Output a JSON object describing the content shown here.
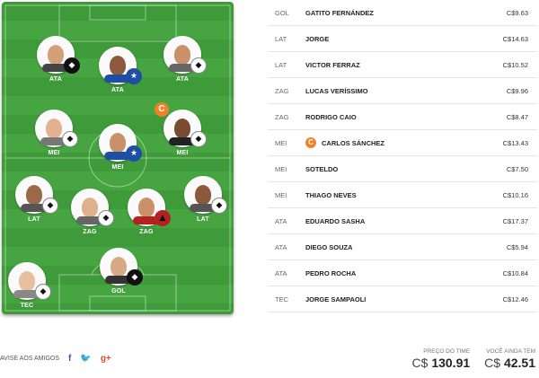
{
  "field": {
    "players": [
      {
        "pos": "ATA",
        "club": "Botafogo",
        "badge": "black",
        "skin": "#d3a07a",
        "shirt": "#444"
      },
      {
        "pos": "ATA",
        "club": "Cruzeiro",
        "badge": "blue",
        "skin": "#8c5a3c",
        "shirt": "#1f4fa3"
      },
      {
        "pos": "ATA",
        "club": "Santos",
        "badge": "white",
        "skin": "#c9906a",
        "shirt": "#666"
      },
      {
        "pos": "MEI",
        "club": "Santos",
        "badge": "white",
        "skin": "#e3b18f",
        "shirt": "#777"
      },
      {
        "pos": "MEI",
        "club": "Cruzeiro",
        "badge": "blue",
        "skin": "#c9906a",
        "shirt": "#1f4fa3"
      },
      {
        "pos": "MEI",
        "club": "Santos",
        "badge": "white",
        "skin": "#7a4b30",
        "shirt": "#222",
        "captain": true
      },
      {
        "pos": "LAT",
        "club": "Santos",
        "badge": "white",
        "skin": "#9a6a48",
        "shirt": "#555"
      },
      {
        "pos": "ZAG",
        "club": "Santos",
        "badge": "white",
        "skin": "#e0b08c",
        "shirt": "#666"
      },
      {
        "pos": "ZAG",
        "club": "Flamengo",
        "badge": "red",
        "skin": "#c9906a",
        "shirt": "#b52020"
      },
      {
        "pos": "LAT",
        "club": "Santos",
        "badge": "white",
        "skin": "#8a5a3a",
        "shirt": "#555"
      },
      {
        "pos": "TEC",
        "club": "Santos",
        "badge": "white",
        "skin": "#e6bfa0",
        "shirt": "#888"
      },
      {
        "pos": "GOL",
        "club": "Botafogo",
        "badge": "black",
        "skin": "#d8a985",
        "shirt": "#333"
      }
    ],
    "captain_letter": "C"
  },
  "list": [
    {
      "pos": "GOL",
      "name": "GATITO FERNÁNDEZ",
      "price": "C$9.63"
    },
    {
      "pos": "LAT",
      "name": "JORGE",
      "price": "C$14.63"
    },
    {
      "pos": "LAT",
      "name": "VICTOR FERRAZ",
      "price": "C$10.52"
    },
    {
      "pos": "ZAG",
      "name": "LUCAS VERÍSSIMO",
      "price": "C$9.96"
    },
    {
      "pos": "ZAG",
      "name": "RODRIGO CAIO",
      "price": "C$8.47"
    },
    {
      "pos": "MEI",
      "name": "CARLOS SÁNCHEZ",
      "price": "C$13.43",
      "captain": true
    },
    {
      "pos": "MEI",
      "name": "SOTELDO",
      "price": "C$7.50"
    },
    {
      "pos": "MEI",
      "name": "THIAGO NEVES",
      "price": "C$10.16"
    },
    {
      "pos": "ATA",
      "name": "EDUARDO SASHA",
      "price": "C$17.37"
    },
    {
      "pos": "ATA",
      "name": "DIEGO SOUZA",
      "price": "C$5.94"
    },
    {
      "pos": "ATA",
      "name": "PEDRO ROCHA",
      "price": "C$10.84"
    },
    {
      "pos": "TEC",
      "name": "JORGE SAMPAOLI",
      "price": "C$12.46"
    }
  ],
  "share": {
    "label": "AVISE AOS AMIGOS",
    "facebook": "f",
    "twitter": "🐦",
    "gplus": "g+"
  },
  "totals": {
    "team_price_label": "PREÇO DO TIME",
    "team_price_currency": "C$",
    "team_price_value": "130.91",
    "remaining_label": "VOCÊ AINDA TEM",
    "remaining_currency": "C$",
    "remaining_value": "42.51"
  },
  "colors": {
    "field_dark": "#3f9a3a",
    "field_light": "#47a541",
    "captain": "#f2802b"
  }
}
